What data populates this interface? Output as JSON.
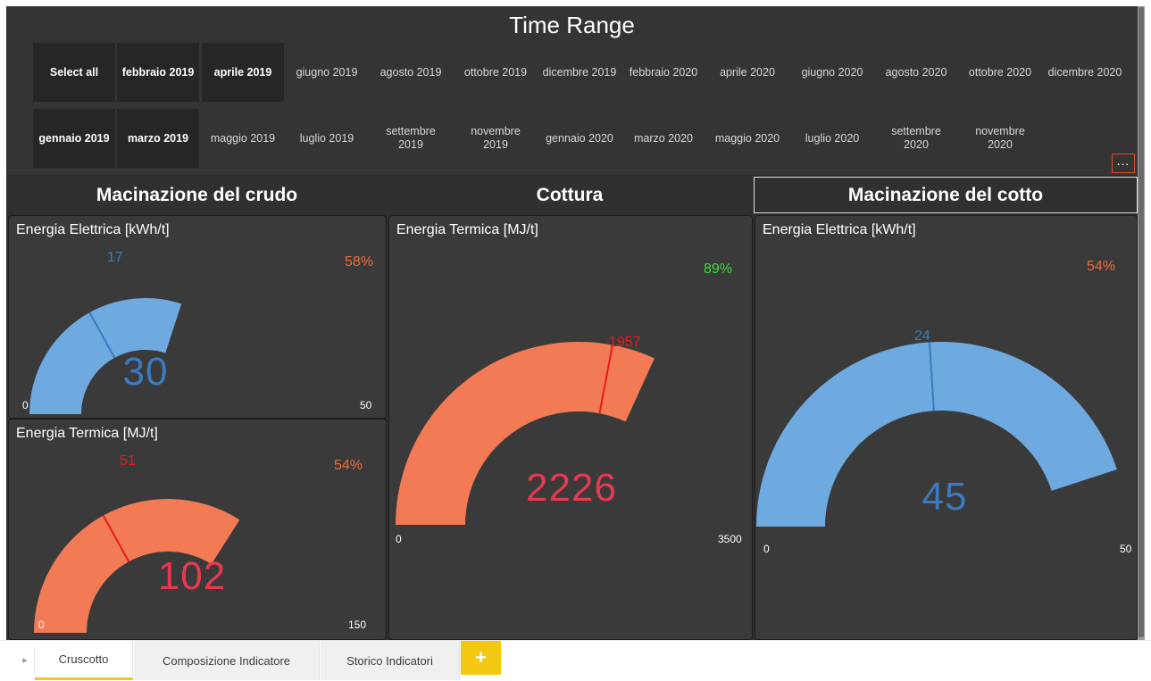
{
  "slicer": {
    "title": "Time Range",
    "more_label": "...",
    "row1": [
      {
        "label": "Select all",
        "selected": true
      },
      {
        "label": "febbraio 2019",
        "selected": true
      },
      {
        "label": "aprile 2019",
        "selected": true
      },
      {
        "label": "giugno 2019",
        "selected": false
      },
      {
        "label": "agosto 2019",
        "selected": false
      },
      {
        "label": "ottobre 2019",
        "selected": false
      },
      {
        "label": "dicembre 2019",
        "selected": false
      },
      {
        "label": "febbraio 2020",
        "selected": false
      },
      {
        "label": "aprile 2020",
        "selected": false
      },
      {
        "label": "giugno 2020",
        "selected": false
      },
      {
        "label": "agosto 2020",
        "selected": false
      },
      {
        "label": "ottobre 2020",
        "selected": false
      },
      {
        "label": "dicembre 2020",
        "selected": false
      }
    ],
    "row2": [
      {
        "label": "gennaio 2019",
        "selected": true
      },
      {
        "label": "marzo 2019",
        "selected": true
      },
      {
        "label": "maggio 2019",
        "selected": false
      },
      {
        "label": "luglio 2019",
        "selected": false
      },
      {
        "label": "settembre 2019",
        "selected": false
      },
      {
        "label": "novembre 2019",
        "selected": false
      },
      {
        "label": "gennaio 2020",
        "selected": false
      },
      {
        "label": "marzo 2020",
        "selected": false
      },
      {
        "label": "maggio 2020",
        "selected": false
      },
      {
        "label": "luglio 2020",
        "selected": false
      },
      {
        "label": "settembre 2020",
        "selected": false
      },
      {
        "label": "novembre 2020",
        "selected": false
      }
    ]
  },
  "sections": {
    "crudo": "Macinazione del crudo",
    "cottura": "Cottura",
    "cotto": "Macinazione del cotto"
  },
  "gauges": {
    "crudo_elettrica": {
      "title": "Energia Elettrica [kWh/t]",
      "value": 30,
      "value_text": "30",
      "min": 0,
      "min_text": "0",
      "max": 50,
      "max_text": "50",
      "target": 17,
      "target_text": "17",
      "percent": "58%",
      "fill_color": "#6eaadf",
      "value_color": "#3a7ac0",
      "target_color": "#3a7ac0",
      "percent_color": "#ef6b3a"
    },
    "crudo_termica": {
      "title": "Energia Termica [MJ/t]",
      "value": 102,
      "value_text": "102",
      "min": 0,
      "min_text": "0",
      "max": 150,
      "max_text": "150",
      "target": 51,
      "target_text": "51",
      "percent": "54%",
      "fill_color": "#f27b55",
      "value_color": "#e8384f",
      "target_color": "#e81c1c",
      "percent_color": "#ef6b3a"
    },
    "cottura_termica": {
      "title": "Energia Termica [MJ/t]",
      "value": 2226,
      "value_text": "2226",
      "min": 0,
      "min_text": "0",
      "max": 3500,
      "max_text": "3500",
      "target": 1957,
      "target_text": "1957",
      "percent": "89%",
      "fill_color": "#f27b55",
      "value_color": "#e8384f",
      "target_color": "#e81c1c",
      "percent_color": "#3ddc3d"
    },
    "cotto_elettrica": {
      "title": "Energia Elettrica [kWh/t]",
      "value": 45,
      "value_text": "45",
      "min": 0,
      "min_text": "0",
      "max": 50,
      "max_text": "50",
      "target": 24,
      "target_text": "24",
      "percent": "54%",
      "fill_color": "#6eaadf",
      "value_color": "#3a7ac0",
      "target_color": "#3a7ac0",
      "percent_color": "#ef6b3a"
    }
  },
  "tabs": {
    "items": [
      "Cruscotto",
      "Composizione Indicatore",
      "Storico Indicatori"
    ],
    "active_index": 0,
    "add_label": "+",
    "nav_label": "▸"
  }
}
